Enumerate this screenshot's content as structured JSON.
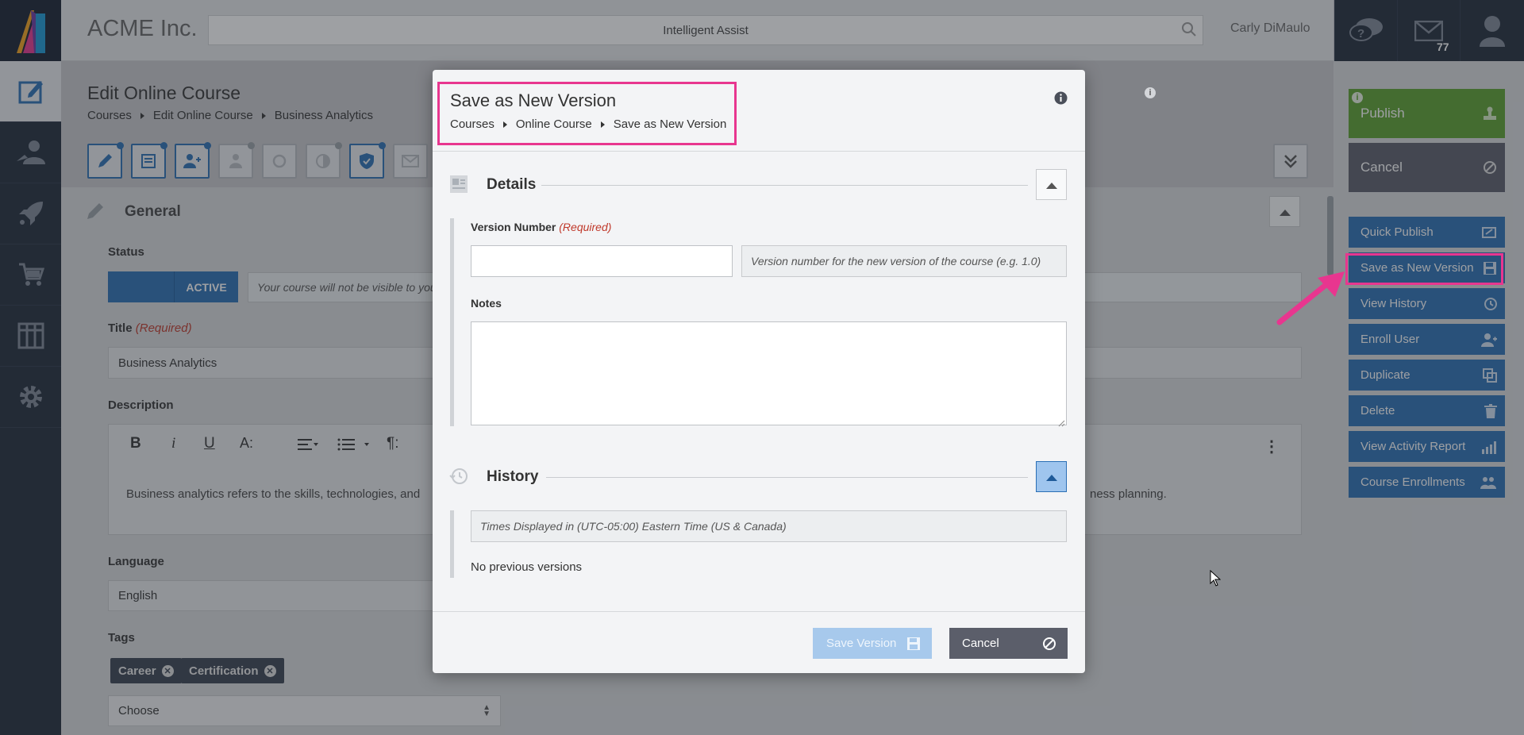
{
  "header": {
    "company": "ACME Inc.",
    "search_label": "Intelligent Assist",
    "user_name": "Carly DiMaulo",
    "message_count": "77"
  },
  "page": {
    "title": "Edit Online Course",
    "breadcrumbs": [
      "Courses",
      "Edit Online Course",
      "Business Analytics"
    ],
    "section_general": "General",
    "status_label": "Status",
    "status_value": "ACTIVE",
    "status_hint": "Your course will not be visible to you",
    "title_label": "Title",
    "required_text": "(Required)",
    "title_value": "Business Analytics",
    "description_label": "Description",
    "description_text": "Business analytics refers to the skills, technologies, and",
    "description_text_end": "ness planning.",
    "language_label": "Language",
    "language_value": "English",
    "tags_label": "Tags",
    "tags": [
      "Career",
      "Certification"
    ],
    "tags_placeholder": "Choose"
  },
  "actions": {
    "publish": "Publish",
    "cancel": "Cancel",
    "items": [
      "Quick Publish",
      "Save as New Version",
      "View History",
      "Enroll User",
      "Duplicate",
      "Delete",
      "View Activity Report",
      "Course Enrollments"
    ]
  },
  "modal": {
    "title": "Save as New Version",
    "breadcrumbs": [
      "Courses",
      "Online Course",
      "Save as New Version"
    ],
    "details_title": "Details",
    "version_label": "Version Number",
    "version_required": "(Required)",
    "version_hint": "Version number for the new version of the course (e.g. 1.0)",
    "notes_label": "Notes",
    "history_title": "History",
    "timezone_note": "Times Displayed in (UTC-05:00) Eastern Time (US & Canada)",
    "no_versions": "No previous versions",
    "save_button": "Save Version",
    "cancel_button": "Cancel"
  },
  "colors": {
    "accent_blue": "#2b6fb5",
    "publish_green": "#5ca12e",
    "highlight_pink": "#e8368f",
    "nav_dark": "#1f2a3a"
  }
}
